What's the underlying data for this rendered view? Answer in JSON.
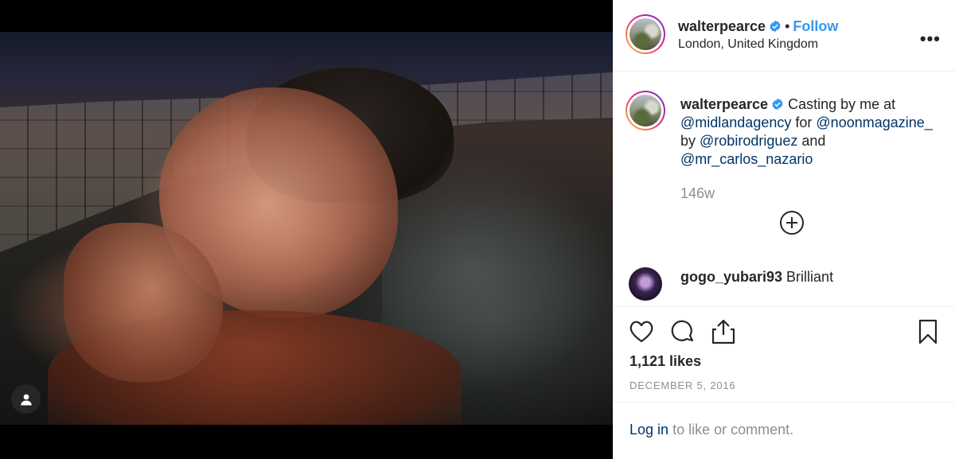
{
  "post": {
    "image_alt": "walterpearce photo",
    "user_tag_icon": "person-icon"
  },
  "header": {
    "username": "walterpearce",
    "separator": "•",
    "follow_label": "Follow",
    "location": "London, United Kingdom",
    "more_label": "•••"
  },
  "caption": {
    "username": "walterpearce",
    "text_1": "Casting by me at",
    "mention_1": "@midlandagency",
    "text_2": "for",
    "mention_2": "@noonmagazine_",
    "text_3": "by",
    "mention_3": "@robirodriguez",
    "text_4": "and",
    "mention_4": "@mr_carlos_nazario",
    "time_ago": "146w"
  },
  "comments": [
    {
      "username": "gogo_yubari93",
      "text": "Brilliant"
    }
  ],
  "actions": {
    "likes": "1,121 likes",
    "date": "DECEMBER 5, 2016"
  },
  "login": {
    "link": "Log in",
    "rest": "to like or comment."
  },
  "colors": {
    "link_blue": "#3897f0",
    "mention_navy": "#003569",
    "muted_gray": "#8e8e8e",
    "text": "#262626"
  }
}
